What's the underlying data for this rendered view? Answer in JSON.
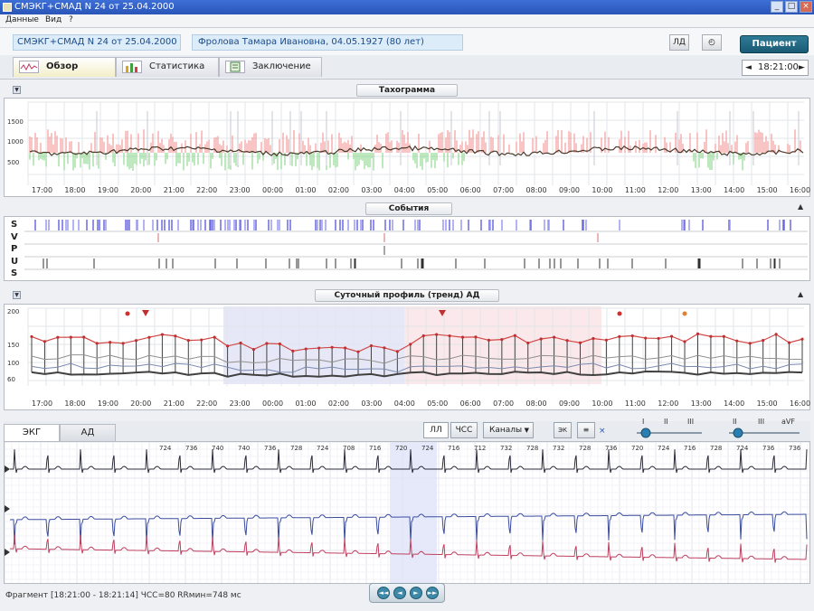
{
  "window": {
    "title": "СМЭКГ+СМАД  N 24 от 25.04.2000",
    "min": "_",
    "max": "□",
    "close": "×"
  },
  "menu": {
    "items": [
      "Данные",
      "Вид",
      "?"
    ]
  },
  "header": {
    "exam": "СМЭКГ+СМАД  N 24 от 25.04.2000",
    "patient": "Фролова Тамара Ивановна, 04.05.1927 (80 лет)",
    "btn_left": "ЛД",
    "btn_right": "◴",
    "patient_button": "Пациент"
  },
  "tabs": [
    {
      "label": "Обзор",
      "active": true
    },
    {
      "label": "Статистика",
      "active": false
    },
    {
      "label": "Заключение",
      "active": false
    }
  ],
  "time_nav": {
    "value": "18:21:00",
    "prev": "◄",
    "next": "►"
  },
  "tachogram": {
    "title": "Тахограмма",
    "y_ticks": [
      "1500",
      "1000",
      "500"
    ],
    "x_ticks": [
      "17:00",
      "18:00",
      "19:00",
      "20:00",
      "21:00",
      "22:00",
      "23:00",
      "00:00",
      "01:00",
      "02:00",
      "03:00",
      "04:00",
      "05:00",
      "06:00",
      "07:00",
      "08:00",
      "09:00",
      "10:00",
      "11:00",
      "12:00",
      "13:00",
      "14:00",
      "15:00",
      "16:00"
    ]
  },
  "events": {
    "title": "События",
    "row_labels": [
      "S",
      "V",
      "P",
      "U",
      "S"
    ]
  },
  "bp": {
    "title": "Суточный профиль (тренд) АД",
    "y_ticks": [
      "200",
      "150",
      "100",
      "60"
    ],
    "x_ticks": [
      "17:00",
      "18:00",
      "19:00",
      "20:00",
      "21:00",
      "22:00",
      "23:00",
      "00:00",
      "01:00",
      "02:00",
      "03:00",
      "04:00",
      "05:00",
      "06:00",
      "07:00",
      "08:00",
      "09:00",
      "10:00",
      "11:00",
      "12:00",
      "13:00",
      "14:00",
      "15:00",
      "16:00"
    ]
  },
  "ecg": {
    "tabs": [
      {
        "label": "ЭКГ",
        "active": true
      },
      {
        "label": "АД",
        "active": false
      }
    ],
    "toggles": [
      "ЛЛ",
      "ЧСС",
      "Каналы"
    ],
    "mini": [
      "ЭК",
      "≡"
    ],
    "slider1": {
      "labels": [
        "I",
        "II",
        "III"
      ]
    },
    "slider2": {
      "labels": [
        "II",
        "III",
        "aVF"
      ]
    },
    "rr_labels": [
      "724",
      "736",
      "740",
      "740",
      "736",
      "728",
      "724",
      "708",
      "716",
      "720",
      "724",
      "716",
      "712",
      "732",
      "728",
      "732",
      "728",
      "736",
      "720",
      "724",
      "716",
      "728",
      "724",
      "736",
      "736"
    ]
  },
  "status": {
    "text": "Фрагмент [18:21:00 - 18:21:14]  ЧСС=80  RRмин=748 мс"
  },
  "player": {
    "buttons": [
      "◄◄",
      "◄",
      "►",
      "►►"
    ]
  },
  "colors": {
    "accent": "#1a5a74",
    "title_bar": "#2a55b8",
    "ecg_red": "#c04060",
    "ecg_blue": "#3a4da0",
    "bp_red": "#e05050"
  }
}
